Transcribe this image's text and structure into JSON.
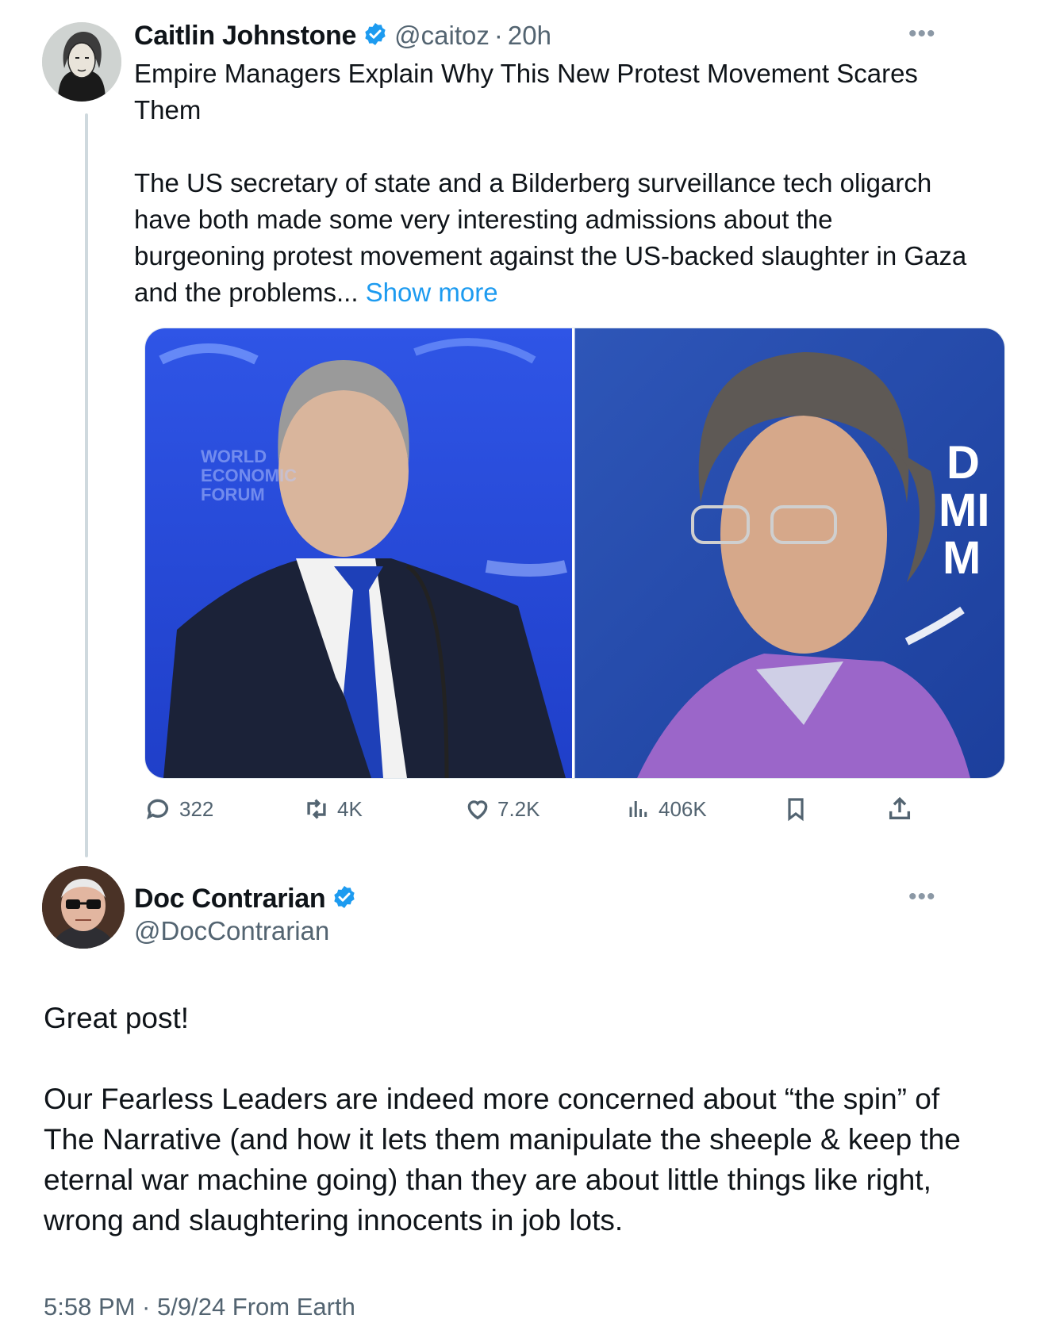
{
  "tweet": {
    "author_name": "Caitlin Johnstone",
    "author_handle": "@caitoz",
    "separator": "·",
    "time": "20h",
    "title_line_1": "Empire Managers Explain Why This New Protest Movement Scares",
    "title_line_2": "Them",
    "body_line_1": "The US secretary of state and a Bilderberg surveillance tech oligarch",
    "body_line_2": "have both made some very interesting admissions about the",
    "body_line_3": "burgeoning protest movement against the US-backed slaughter in Gaza",
    "body_line_4": "and the problems...",
    "show_more": "Show more",
    "media_left_backdrop_text": "WORLD ECONOMIC FORUM",
    "media_right_backdrop_letters": [
      "D",
      "MI",
      "M"
    ],
    "stats": {
      "replies": "322",
      "reposts": "4K",
      "likes": "7.2K",
      "views": "406K"
    },
    "more_icon": "more-horizontal-icon"
  },
  "reply": {
    "author_name": "Doc Contrarian",
    "author_handle": "@DocContrarian",
    "text_line_1": "Great post!",
    "text_line_2": "Our Fearless Leaders are indeed more concerned about “the spin” of",
    "text_line_3": "The Narrative (and how it lets them manipulate the sheeple & keep the",
    "text_line_4": "eternal war machine going) than they are about little things like right,",
    "text_line_5": "wrong and slaughtering innocents in job lots.",
    "timestamp": "5:58 PM · 5/9/24 From Earth"
  },
  "colors": {
    "link_blue": "#1d9bf0",
    "verified_blue": "#1d9bf0",
    "secondary_text": "#536471",
    "thread_line": "#cfd9de"
  }
}
